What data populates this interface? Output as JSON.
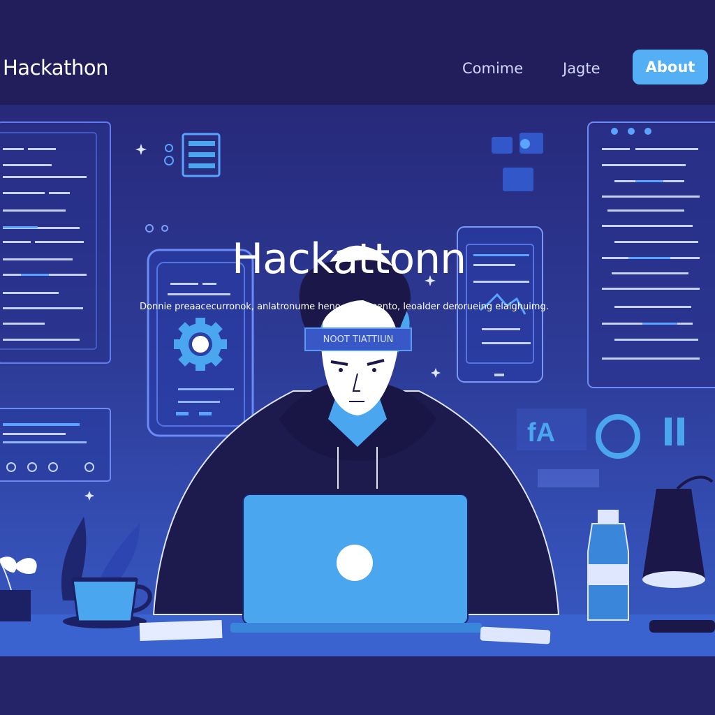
{
  "nav": {
    "brand": "Hackathon",
    "links": [
      "Comime",
      "Jagte"
    ],
    "button_label": "About"
  },
  "hero": {
    "title": "Hackattonn",
    "subtitle": "Donnie preaacecurronok, anlatronume heno comercento, leoalder derorueing elaighuimg.",
    "cta_label": "NOOT TIATTIUN"
  },
  "icons": {
    "gear": "gear-icon",
    "chart": "line-chart-icon"
  },
  "colors": {
    "background": "#1f1c57",
    "accent": "#55aff5",
    "laptop": "#4aa7ef"
  }
}
